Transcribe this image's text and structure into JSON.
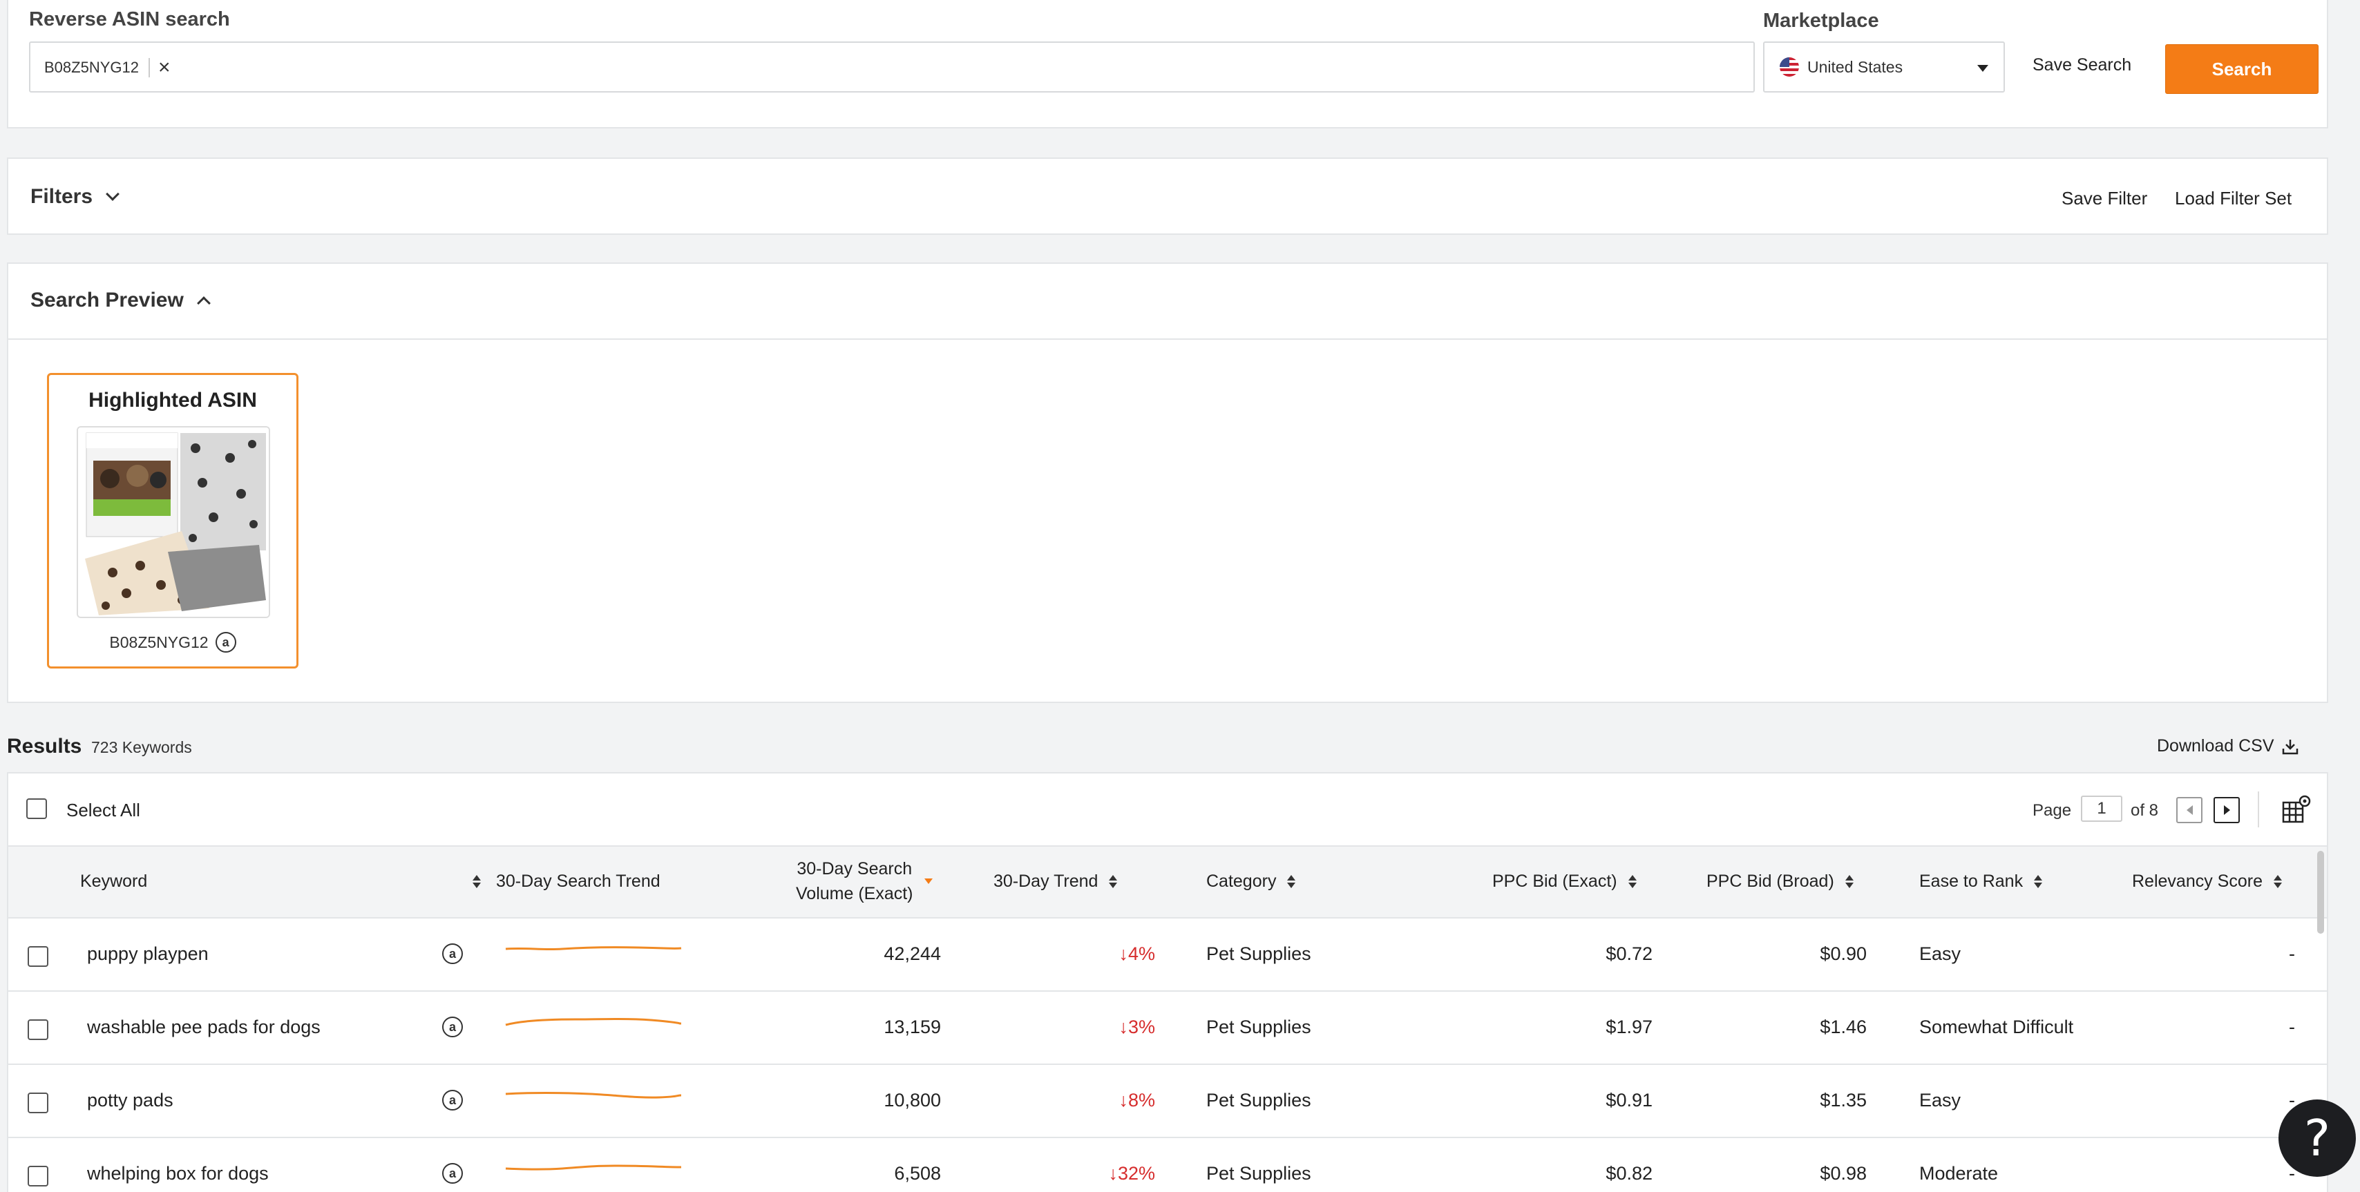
{
  "search": {
    "label": "Reverse ASIN search",
    "chip_value": "B08Z5NYG12",
    "marketplace_label": "Marketplace",
    "marketplace_value": "United States",
    "save_search": "Save Search",
    "search_button": "Search"
  },
  "filters": {
    "title": "Filters",
    "save_filter": "Save Filter",
    "load_filter_set": "Load Filter Set"
  },
  "preview": {
    "title": "Search Preview",
    "card_title": "Highlighted ASIN",
    "card_asin": "B08Z5NYG12"
  },
  "results": {
    "title": "Results",
    "count": "723 Keywords",
    "download_csv": "Download CSV",
    "select_all": "Select All",
    "page_label": "Page",
    "page_value": "1",
    "page_of": "of 8",
    "columns": {
      "keyword": "Keyword",
      "search_trend": "30-Day Search Trend",
      "volume_line1": "30-Day Search",
      "volume_line2": "Volume (Exact)",
      "trend": "30-Day Trend",
      "category": "Category",
      "ppc_exact": "PPC Bid (Exact)",
      "ppc_broad": "PPC Bid (Broad)",
      "ease": "Ease to Rank",
      "relevancy": "Relevancy Score"
    },
    "rows": [
      {
        "keyword": "puppy playpen",
        "volume": "42,244",
        "trend": "↓4%",
        "category": "Pet Supplies",
        "ppc_exact": "$0.72",
        "ppc_broad": "$0.90",
        "ease": "Easy",
        "relevancy": "-"
      },
      {
        "keyword": "washable pee pads for dogs",
        "volume": "13,159",
        "trend": "↓3%",
        "category": "Pet Supplies",
        "ppc_exact": "$1.97",
        "ppc_broad": "$1.46",
        "ease": "Somewhat Difficult",
        "relevancy": "-"
      },
      {
        "keyword": "potty pads",
        "volume": "10,800",
        "trend": "↓8%",
        "category": "Pet Supplies",
        "ppc_exact": "$0.91",
        "ppc_broad": "$1.35",
        "ease": "Easy",
        "relevancy": "-"
      },
      {
        "keyword": "whelping box for dogs",
        "volume": "6,508",
        "trend": "↓32%",
        "category": "Pet Supplies",
        "ppc_exact": "$0.82",
        "ppc_broad": "$0.98",
        "ease": "Moderate",
        "relevancy": "-"
      }
    ]
  },
  "icons": {
    "amazon": "amazon-icon",
    "help": "?"
  },
  "colors": {
    "accent": "#f47c16",
    "trend_down": "#d62d2d",
    "sparkline": "#f08a24"
  }
}
